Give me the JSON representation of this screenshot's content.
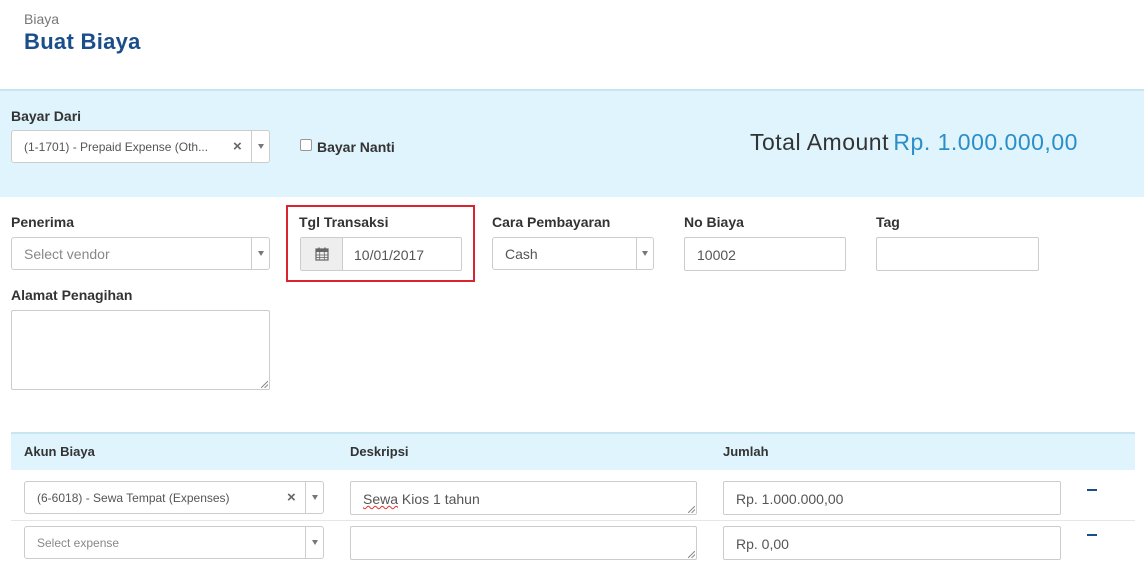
{
  "header": {
    "breadcrumb": "Biaya",
    "title": "Buat Biaya"
  },
  "pay_from": {
    "label": "Bayar Dari",
    "value": "(1-1701) - Prepaid Expense (Oth...",
    "clear_symbol": "×"
  },
  "pay_later": {
    "label": "Bayar Nanti",
    "checked": false
  },
  "total": {
    "label": "Total Amount",
    "value": "Rp. 1.000.000,00"
  },
  "form": {
    "recipient": {
      "label": "Penerima",
      "placeholder": "Select vendor"
    },
    "transaction_date": {
      "label": "Tgl Transaksi",
      "value": "10/01/2017"
    },
    "payment_method": {
      "label": "Cara Pembayaran",
      "value": "Cash"
    },
    "expense_no": {
      "label": "No Biaya",
      "value": "10002"
    },
    "tag": {
      "label": "Tag",
      "value": ""
    },
    "billing_address": {
      "label": "Alamat Penagihan",
      "value": ""
    }
  },
  "table": {
    "columns": [
      "Akun Biaya",
      "Deskripsi",
      "Jumlah"
    ],
    "rows": [
      {
        "account": "(6-6018) - Sewa Tempat (Expenses)",
        "account_placeholder": "",
        "description_word1": "Sewa",
        "description_rest": " Kios 1 tahun",
        "amount": "Rp. 1.000.000,00",
        "clear_symbol": "×"
      },
      {
        "account": "",
        "account_placeholder": "Select expense",
        "description_word1": "",
        "description_rest": "",
        "amount": "Rp. 0,00",
        "clear_symbol": ""
      }
    ]
  },
  "colors": {
    "title": "#1a4e8a",
    "accent": "#2a8fc8",
    "band": "#dff4fc",
    "highlight": "#d9232e"
  },
  "icons": {
    "calendar": "calendar-icon",
    "caret": "chevron-down-icon",
    "remove": "minus-icon",
    "clear": "close-icon"
  }
}
